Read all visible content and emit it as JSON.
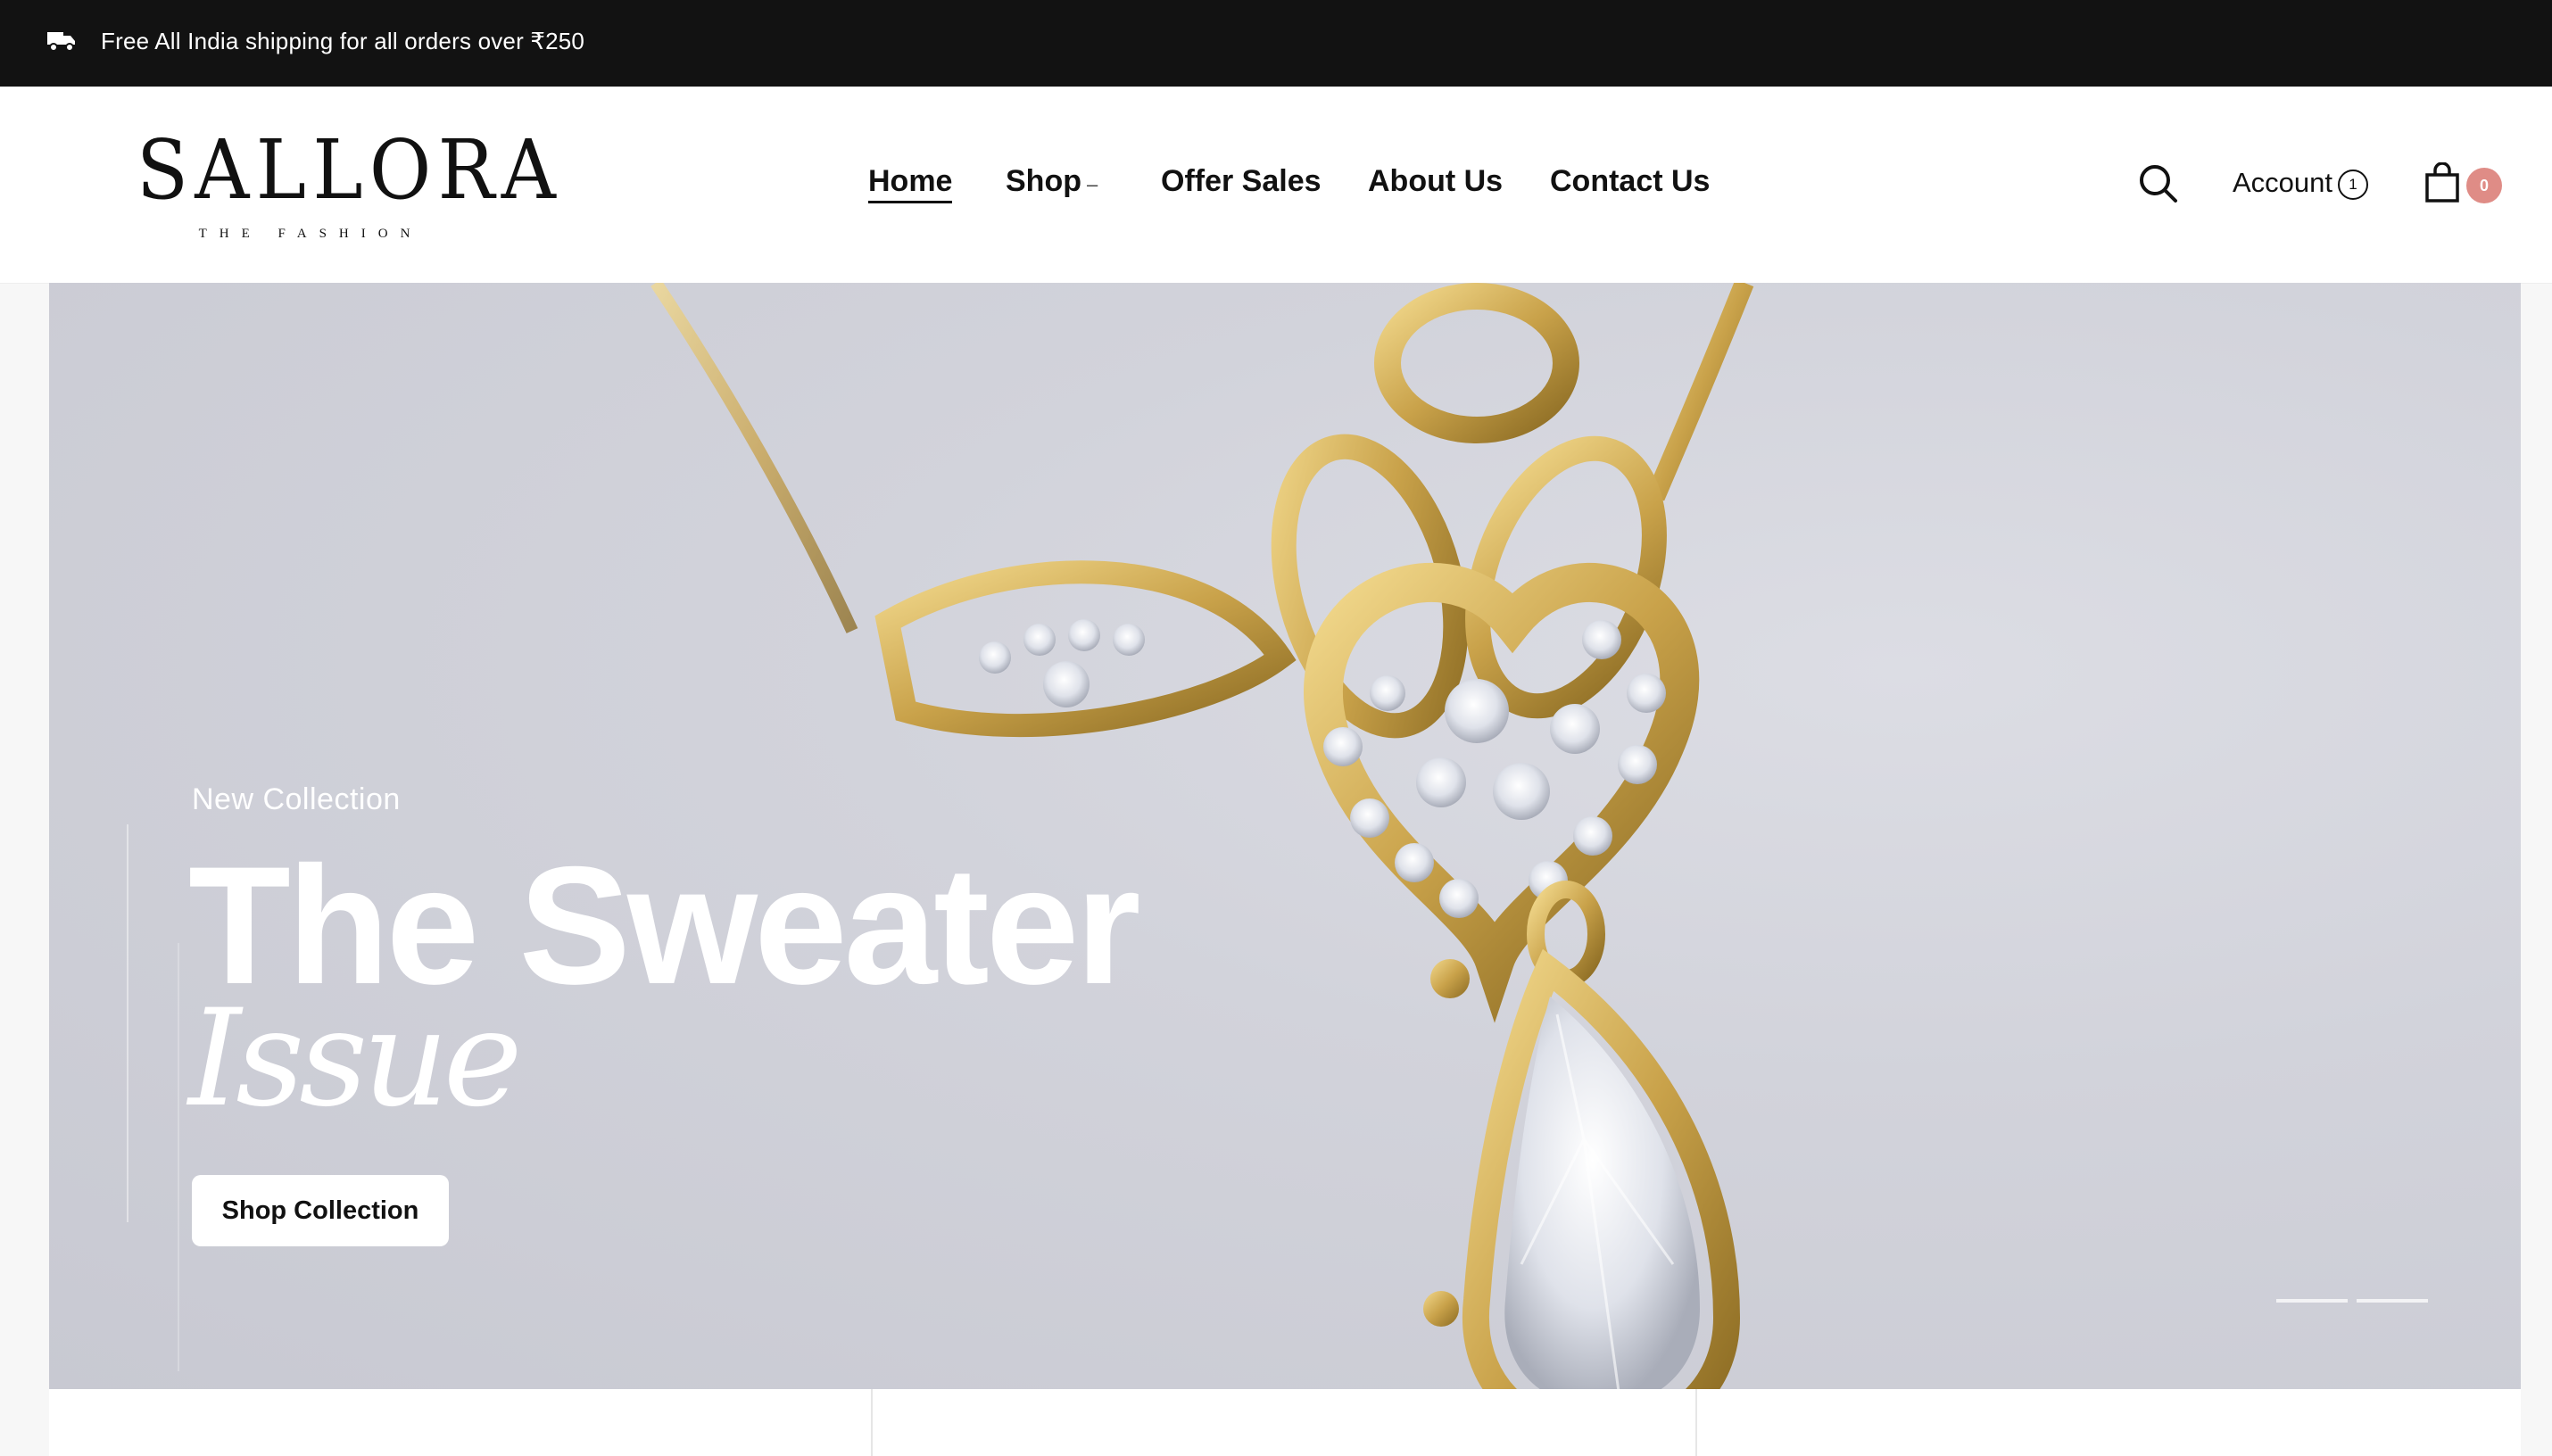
{
  "announcement": {
    "text": "Free All India shipping for all orders over ₹250"
  },
  "header": {
    "logo": {
      "name": "SALLORA",
      "tagline": "THE FASHION"
    },
    "nav": [
      {
        "label": "Home",
        "active": true
      },
      {
        "label": "Shop",
        "has_dropdown": true
      },
      {
        "label": "Offer Sales"
      },
      {
        "label": "About Us"
      },
      {
        "label": "Contact Us"
      }
    ],
    "account": {
      "label": "Account",
      "badge": "1"
    },
    "cart": {
      "count": "0",
      "badge_color": "#df8c86"
    }
  },
  "hero": {
    "kicker": "New Collection",
    "title": "The Sweater",
    "subtitle": "Issue",
    "cta": "Shop Collection",
    "slides": 2
  },
  "colors": {
    "announcement_bg": "#121212",
    "hero_bg": "#d2d3db",
    "gold": "#c9a24a"
  },
  "icons": {
    "announcement": "truck-icon",
    "search": "search-icon",
    "account": "user-icon",
    "cart": "shopping-bag-icon"
  }
}
